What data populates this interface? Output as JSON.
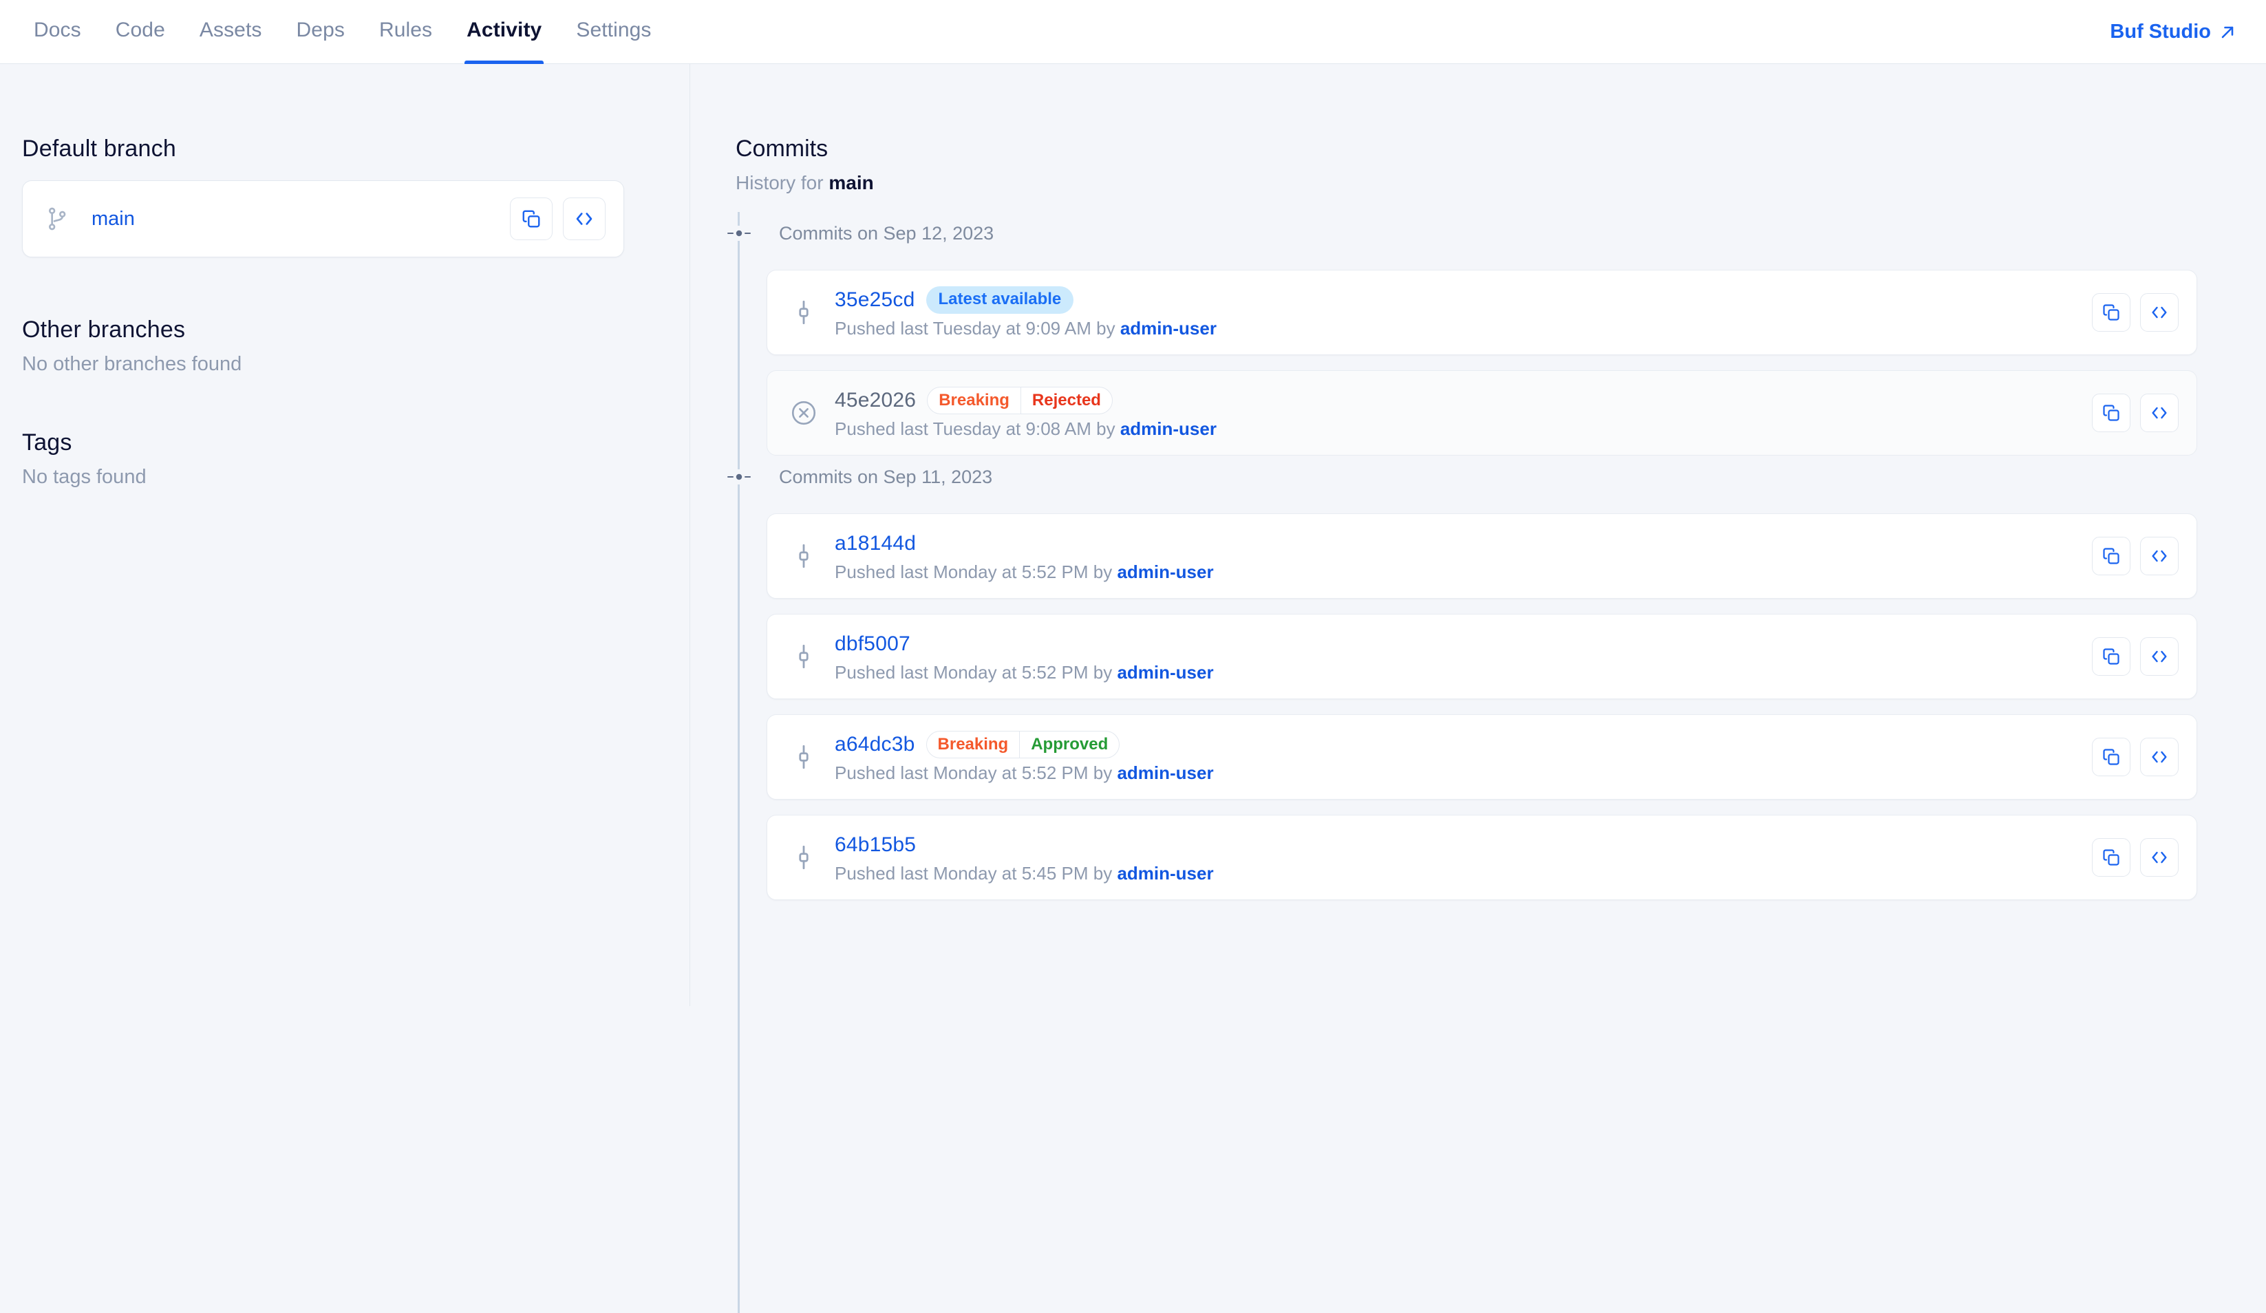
{
  "nav": {
    "tabs": [
      {
        "label": "Docs",
        "active": false
      },
      {
        "label": "Code",
        "active": false
      },
      {
        "label": "Assets",
        "active": false
      },
      {
        "label": "Deps",
        "active": false
      },
      {
        "label": "Rules",
        "active": false
      },
      {
        "label": "Activity",
        "active": true
      },
      {
        "label": "Settings",
        "active": false
      }
    ],
    "studio_link": "Buf Studio",
    "studio_icon": "external-link-icon"
  },
  "sidebar": {
    "default_branch_heading": "Default branch",
    "branch": {
      "icon": "git-branch-icon",
      "name": "main",
      "copy_label": "copy-icon",
      "code_label": "code-icon"
    },
    "other_branches_heading": "Other branches",
    "other_branches_empty": "No other branches found",
    "tags_heading": "Tags",
    "tags_empty": "No tags found"
  },
  "main": {
    "heading": "Commits",
    "subtitle_prefix": "History for ",
    "subtitle_branch": "main",
    "groups": [
      {
        "label": "Commits on Sep 12, 2023",
        "commits": [
          {
            "sha": "35e25cd",
            "sha_is_link": true,
            "status_icon": "git-commit-icon",
            "solid_badge": "Latest available",
            "badges": [],
            "meta_prefix": "Pushed last Tuesday at 9:09 AM by ",
            "author": "admin-user",
            "muted_card": false
          },
          {
            "sha": "45e2026",
            "sha_is_link": false,
            "status_icon": "x-circle-icon",
            "solid_badge": null,
            "badges": [
              {
                "label": "Breaking",
                "tone": "breaking"
              },
              {
                "label": "Rejected",
                "tone": "rejected"
              }
            ],
            "meta_prefix": "Pushed last Tuesday at 9:08 AM by ",
            "author": "admin-user",
            "muted_card": true
          }
        ]
      },
      {
        "label": "Commits on Sep 11, 2023",
        "commits": [
          {
            "sha": "a18144d",
            "sha_is_link": true,
            "status_icon": "git-commit-icon",
            "solid_badge": null,
            "badges": [],
            "meta_prefix": "Pushed last Monday at 5:52 PM by ",
            "author": "admin-user",
            "muted_card": false
          },
          {
            "sha": "dbf5007",
            "sha_is_link": true,
            "status_icon": "git-commit-icon",
            "solid_badge": null,
            "badges": [],
            "meta_prefix": "Pushed last Monday at 5:52 PM by ",
            "author": "admin-user",
            "muted_card": false
          },
          {
            "sha": "a64dc3b",
            "sha_is_link": true,
            "status_icon": "git-commit-icon",
            "solid_badge": null,
            "badges": [
              {
                "label": "Breaking",
                "tone": "breaking"
              },
              {
                "label": "Approved",
                "tone": "approved"
              }
            ],
            "meta_prefix": "Pushed last Monday at 5:52 PM by ",
            "author": "admin-user",
            "muted_card": false
          },
          {
            "sha": "64b15b5",
            "sha_is_link": true,
            "status_icon": "git-commit-icon",
            "solid_badge": null,
            "badges": [],
            "meta_prefix": "Pushed last Monday at 5:45 PM by ",
            "author": "admin-user",
            "muted_card": false
          }
        ]
      }
    ],
    "row_actions": {
      "copy": "copy-icon",
      "code": "code-icon"
    }
  },
  "colors": {
    "accent": "#1a63ef",
    "link": "#1257e0",
    "breaking": "#f4592c",
    "rejected": "#e8361c",
    "approved": "#259b35",
    "badge_blue_bg": "#cceafd",
    "page_bg": "#f4f6fa"
  }
}
